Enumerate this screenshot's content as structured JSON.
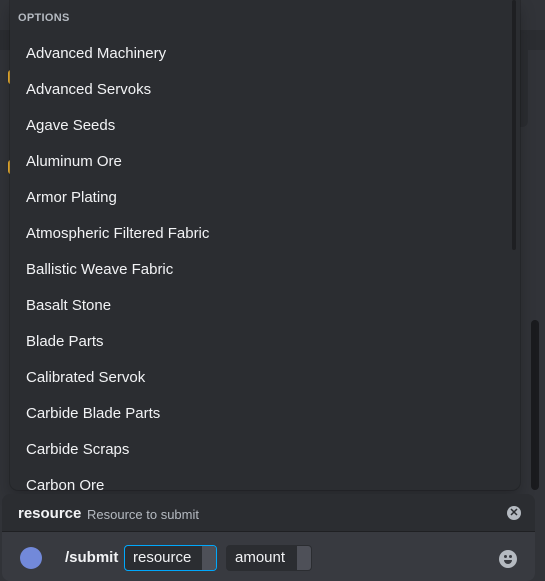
{
  "popup": {
    "header": "OPTIONS",
    "options": [
      "Advanced Machinery",
      "Advanced Servoks",
      "Agave Seeds",
      "Aluminum Ore",
      "Armor Plating",
      "Atmospheric Filtered Fabric",
      "Ballistic Weave Fabric",
      "Basalt Stone",
      "Blade Parts",
      "Calibrated Servok",
      "Carbide Blade Parts",
      "Carbide Scraps",
      "Carbon Ore"
    ]
  },
  "hint": {
    "param_name": "resource",
    "param_description": "Resource to submit",
    "close_icon": "close-circle-icon"
  },
  "input": {
    "avatar_icon": "app-avatar-icon",
    "command": "/submit",
    "params": [
      "resource",
      "amount"
    ],
    "emoji_icon": "emoji-icon"
  },
  "colors": {
    "accent_focus": "#00a8fc",
    "popup_bg": "#2b2d31",
    "input_bg": "#383a40"
  }
}
